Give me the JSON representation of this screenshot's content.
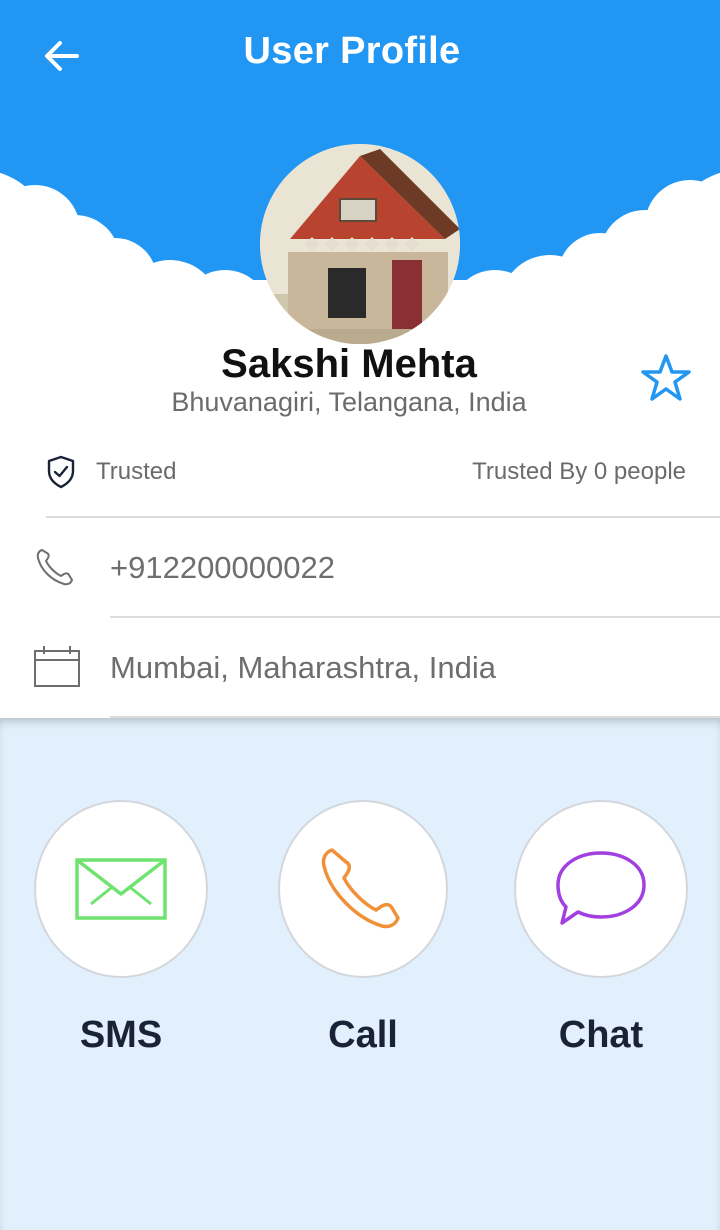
{
  "header": {
    "title": "User Profile",
    "back_icon": "arrow-left-icon",
    "color": "#2196F3"
  },
  "profile": {
    "name": "Sakshi Mehta",
    "location": "Bhuvanagiri, Telangana, India",
    "avatar": "house-photo",
    "star_icon": "star-outline-icon"
  },
  "trust": {
    "icon": "shield-check-icon",
    "label": "Trusted",
    "count_text": "Trusted By 0 people"
  },
  "details": {
    "phone": {
      "icon": "phone-icon",
      "value": "+912200000022"
    },
    "address": {
      "icon": "calendar-icon",
      "value": "Mumbai, Maharashtra, India"
    }
  },
  "actions": [
    {
      "label": "SMS",
      "icon": "envelope-icon",
      "color": "#6FE36F"
    },
    {
      "label": "Call",
      "icon": "phone-handset-icon",
      "color": "#F0913A"
    },
    {
      "label": "Chat",
      "icon": "chat-bubble-icon",
      "color": "#A23FE0"
    }
  ],
  "colors": {
    "accent": "#2196F3",
    "panel": "#E2F0FD"
  }
}
